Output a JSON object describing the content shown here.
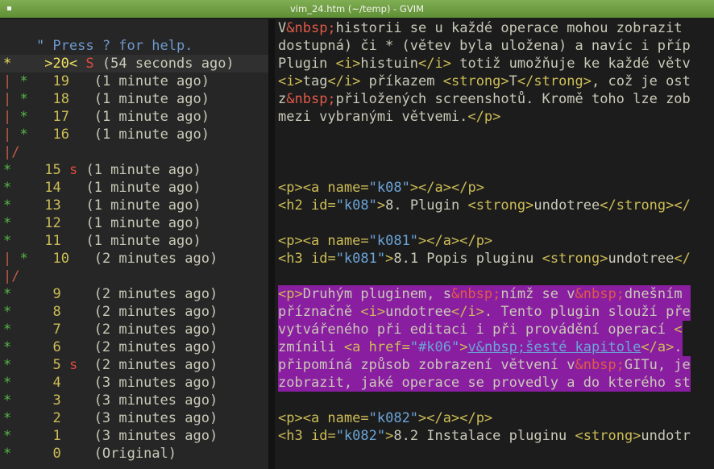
{
  "window": {
    "title": "vim_24.htm (~/temp) - GVIM"
  },
  "undotree": {
    "help": "\" Press ? for help.",
    "rows": [
      {
        "graph": "*",
        "seq": ">20<",
        "saved": "S",
        "time": "(54 seconds ago)",
        "current": true
      },
      {
        "graph": "| *",
        "seq": "19",
        "saved": "",
        "time": "(1 minute ago)"
      },
      {
        "graph": "| *",
        "seq": "18",
        "saved": "",
        "time": "(1 minute ago)"
      },
      {
        "graph": "| *",
        "seq": "17",
        "saved": "",
        "time": "(1 minute ago)"
      },
      {
        "graph": "| *",
        "seq": "16",
        "saved": "",
        "time": "(1 minute ago)"
      },
      {
        "graph": "|/",
        "seq": "",
        "saved": "",
        "time": ""
      },
      {
        "graph": "*",
        "seq": "15",
        "saved": "s",
        "time": "(1 minute ago)"
      },
      {
        "graph": "*",
        "seq": "14",
        "saved": "",
        "time": "(1 minute ago)"
      },
      {
        "graph": "*",
        "seq": "13",
        "saved": "",
        "time": "(1 minute ago)"
      },
      {
        "graph": "*",
        "seq": "12",
        "saved": "",
        "time": "(1 minute ago)"
      },
      {
        "graph": "*",
        "seq": "11",
        "saved": "",
        "time": "(1 minute ago)"
      },
      {
        "graph": "| *",
        "seq": "10",
        "saved": "",
        "time": "(2 minutes ago)"
      },
      {
        "graph": "|/",
        "seq": "",
        "saved": "",
        "time": ""
      },
      {
        "graph": "*",
        "seq": "9",
        "saved": "",
        "time": "(2 minutes ago)"
      },
      {
        "graph": "*",
        "seq": "8",
        "saved": "",
        "time": "(2 minutes ago)"
      },
      {
        "graph": "*",
        "seq": "7",
        "saved": "",
        "time": "(2 minutes ago)"
      },
      {
        "graph": "*",
        "seq": "6",
        "saved": "",
        "time": "(2 minutes ago)"
      },
      {
        "graph": "*",
        "seq": "5",
        "saved": "s",
        "time": "(2 minutes ago)"
      },
      {
        "graph": "*",
        "seq": "4",
        "saved": "",
        "time": "(3 minutes ago)"
      },
      {
        "graph": "*",
        "seq": "3",
        "saved": "",
        "time": "(3 minutes ago)"
      },
      {
        "graph": "*",
        "seq": "2",
        "saved": "",
        "time": "(3 minutes ago)"
      },
      {
        "graph": "*",
        "seq": "1",
        "saved": "",
        "time": "(3 minutes ago)"
      },
      {
        "graph": "*",
        "seq": "0",
        "saved": "",
        "time": "(Original)"
      }
    ]
  },
  "editor": {
    "lines": [
      [
        [
          "tx",
          "V"
        ],
        [
          "en",
          "&nbsp;"
        ],
        [
          "tx",
          "historii se u každé operace mohou zobrazit"
        ]
      ],
      [
        [
          "tx",
          "dostupná) či * (větev byla uložena) a navíc i příp"
        ]
      ],
      [
        [
          "tx",
          "Plugin "
        ],
        [
          "tg",
          "<i>"
        ],
        [
          "tx",
          "histuin"
        ],
        [
          "tg",
          "</i>"
        ],
        [
          "tx",
          " totiž umožňuje ke každé větv"
        ]
      ],
      [
        [
          "tg",
          "<i>"
        ],
        [
          "tx",
          "tag"
        ],
        [
          "tg",
          "</i>"
        ],
        [
          "tx",
          " příkazem "
        ],
        [
          "tg",
          "<strong>"
        ],
        [
          "tx",
          "T"
        ],
        [
          "tg",
          "</strong>"
        ],
        [
          "tx",
          ", což je ost"
        ]
      ],
      [
        [
          "tx",
          "z"
        ],
        [
          "en",
          "&nbsp;"
        ],
        [
          "tx",
          "přiložených screenshotů. Kromě toho lze zob"
        ]
      ],
      [
        [
          "tx",
          "mezi vybranými větvemi."
        ],
        [
          "tg",
          "</p>"
        ]
      ],
      [],
      [],
      [],
      [
        [
          "tg",
          "<p><a "
        ],
        [
          "at",
          "name"
        ],
        [
          "tg",
          "="
        ],
        [
          "vl",
          "\"k08\""
        ],
        [
          "tg",
          "></a></p>"
        ]
      ],
      [
        [
          "tg",
          "<h2 "
        ],
        [
          "at",
          "id"
        ],
        [
          "tg",
          "="
        ],
        [
          "vl",
          "\"k08\""
        ],
        [
          "tg",
          ">"
        ],
        [
          "tx",
          "8. Plugin "
        ],
        [
          "tg",
          "<strong>"
        ],
        [
          "tx",
          "undotree"
        ],
        [
          "tg",
          "</strong></"
        ]
      ],
      [],
      [
        [
          "tg",
          "<p><a "
        ],
        [
          "at",
          "name"
        ],
        [
          "tg",
          "="
        ],
        [
          "vl",
          "\"k081\""
        ],
        [
          "tg",
          "></a></p>"
        ]
      ],
      [
        [
          "tg",
          "<h3 "
        ],
        [
          "at",
          "id"
        ],
        [
          "tg",
          "="
        ],
        [
          "vl",
          "\"k081\""
        ],
        [
          "tg",
          ">"
        ],
        [
          "tx",
          "8.1 Popis pluginu "
        ],
        [
          "tg",
          "<strong>"
        ],
        [
          "tx",
          "undotree"
        ],
        [
          "tg",
          "</"
        ]
      ],
      [],
      [
        [
          "tg",
          "<p>"
        ],
        [
          "tx",
          "Druhým pluginem, s"
        ],
        [
          "en",
          "&nbsp;"
        ],
        [
          "tx",
          "nímž se v"
        ],
        [
          "en",
          "&nbsp;"
        ],
        [
          "tx",
          "dnešním "
        ]
      ],
      [
        [
          "tx",
          "příznačně "
        ],
        [
          "tg",
          "<i>"
        ],
        [
          "tx",
          "undotree"
        ],
        [
          "tg",
          "</i>"
        ],
        [
          "tx",
          ". Tento plugin slouží pře"
        ]
      ],
      [
        [
          "tx",
          "vytvářeného při editaci i při provádění operací "
        ],
        [
          "tg",
          "<"
        ]
      ],
      [
        [
          "tx",
          "zmínili "
        ],
        [
          "tg",
          "<a "
        ],
        [
          "at",
          "href"
        ],
        [
          "tg",
          "="
        ],
        [
          "vl",
          "\"#k06\""
        ],
        [
          "tg",
          ">"
        ],
        [
          "link",
          "v&nbsp;šesté kapitole"
        ],
        [
          "tg",
          "</a>"
        ],
        [
          "tx",
          "."
        ]
      ],
      [
        [
          "tx",
          "připomíná způsob zobrazení větvení v"
        ],
        [
          "en",
          "&nbsp;"
        ],
        [
          "tx",
          "GITu, je"
        ]
      ],
      [
        [
          "tx",
          "zobrazit, jaké operace se provedly a do kterého st"
        ]
      ],
      [],
      [
        [
          "tg",
          "<p><a "
        ],
        [
          "at",
          "name"
        ],
        [
          "tg",
          "="
        ],
        [
          "vl",
          "\"k082\""
        ],
        [
          "tg",
          "></a></p>"
        ]
      ],
      [
        [
          "tg",
          "<h3 "
        ],
        [
          "at",
          "id"
        ],
        [
          "tg",
          "="
        ],
        [
          "vl",
          "\"k082\""
        ],
        [
          "tg",
          ">"
        ],
        [
          "tx",
          "8.2 Instalace pluginu "
        ],
        [
          "tg",
          "<strong>"
        ],
        [
          "tx",
          "undotr"
        ]
      ]
    ],
    "highlight_lines": [
      15,
      16,
      17,
      18,
      19,
      20
    ]
  },
  "colors": {
    "highlight": "#8a1ea0",
    "titlebar": "#6f9e45",
    "background": "#1c1c1c"
  }
}
